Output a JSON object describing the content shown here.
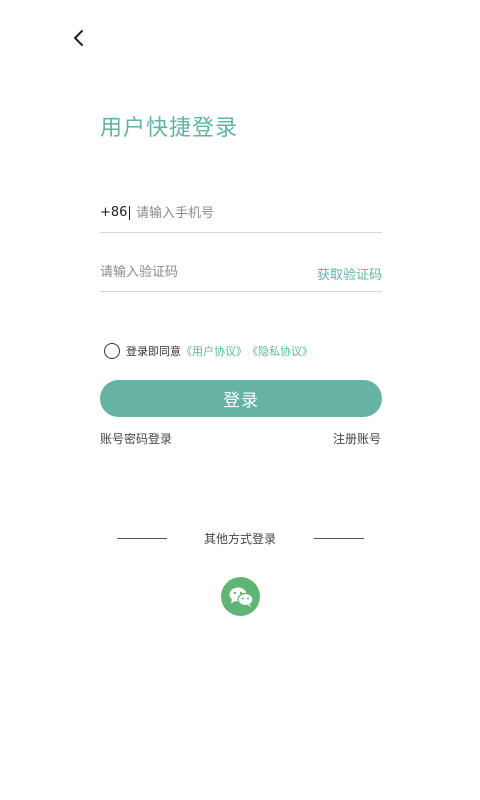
{
  "header": {
    "back_icon": "chevron-left-icon"
  },
  "title": "用户快捷登录",
  "phone": {
    "country_code": "+86",
    "placeholder": "请输入手机号",
    "value": ""
  },
  "code": {
    "placeholder": "请输入验证码",
    "value": "",
    "get_code_label": "获取验证码"
  },
  "agreement": {
    "checked": false,
    "prefix": "登录即同意",
    "user_agreement": "《用户协议》",
    "privacy_policy": "《隐私协议》"
  },
  "login_button_label": "登录",
  "links": {
    "password_login": "账号密码登录",
    "register": "注册账号"
  },
  "other_login": {
    "title": "其他方式登录",
    "wechat_icon": "wechat-icon"
  },
  "colors": {
    "accent": "#62b3a4",
    "button": "#66b3a4",
    "wechat": "#5fb574"
  }
}
